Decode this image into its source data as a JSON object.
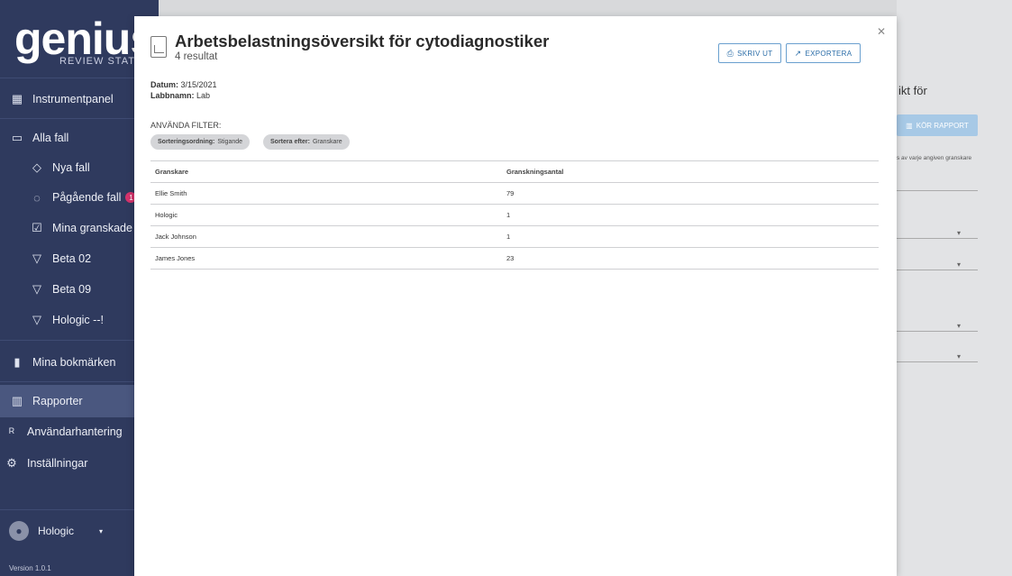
{
  "sidebar": {
    "logo": "genius",
    "logo_sub": "REVIEW STATIO",
    "items": [
      {
        "label": "Instrumentpanel",
        "icon": "dashboard-icon"
      },
      {
        "label": "Alla fall",
        "icon": "folder-icon"
      },
      {
        "label": "Nya fall",
        "icon": "tag-icon"
      },
      {
        "label": "Pågående fall",
        "icon": "progress-icon",
        "badge": "1"
      },
      {
        "label": "Mina granskade fal",
        "icon": "checkbox-icon"
      },
      {
        "label": "Beta 02",
        "icon": "filter-icon"
      },
      {
        "label": "Beta 09",
        "icon": "filter-icon"
      },
      {
        "label": "Hologic --!",
        "icon": "filter-icon"
      },
      {
        "label": "Mina bokmärken",
        "icon": "bookmark-icon"
      },
      {
        "label": "Rapporter",
        "icon": "reports-icon"
      },
      {
        "label": "Användarhantering",
        "icon": "users-icon"
      },
      {
        "label": "Inställningar",
        "icon": "gear-icon"
      }
    ],
    "user": "Hologic",
    "version": "Version 1.0.1"
  },
  "background": {
    "title": "ikt för",
    "run_button": "KÖR RAPPORT",
    "desc": "s av varje angiven granskare"
  },
  "modal": {
    "title": "Arbetsbelastningsöversikt för cytodiagnostiker",
    "subtitle": "4 resultat",
    "print": "SKRIV UT",
    "export": "EXPORTERA",
    "date_label": "Datum:",
    "date_value": "3/15/2021",
    "lab_label": "Labbnamn:",
    "lab_value": "Lab",
    "filters_label": "ANVÄNDA FILTER:",
    "chips": [
      {
        "key": "Sorteringsordning:",
        "value": "Stigande"
      },
      {
        "key": "Sortera efter:",
        "value": "Granskare"
      }
    ],
    "table": {
      "headers": [
        "Granskare",
        "Granskningsantal"
      ],
      "rows": [
        [
          "Ellie Smith",
          "79"
        ],
        [
          "Hologic",
          "1"
        ],
        [
          "Jack Johnson",
          "1"
        ],
        [
          "James Jones",
          "23"
        ]
      ]
    }
  },
  "colors": {
    "sidebar": "#2f3a5e",
    "accent": "#2c6ea8",
    "badge": "#d6336c"
  }
}
